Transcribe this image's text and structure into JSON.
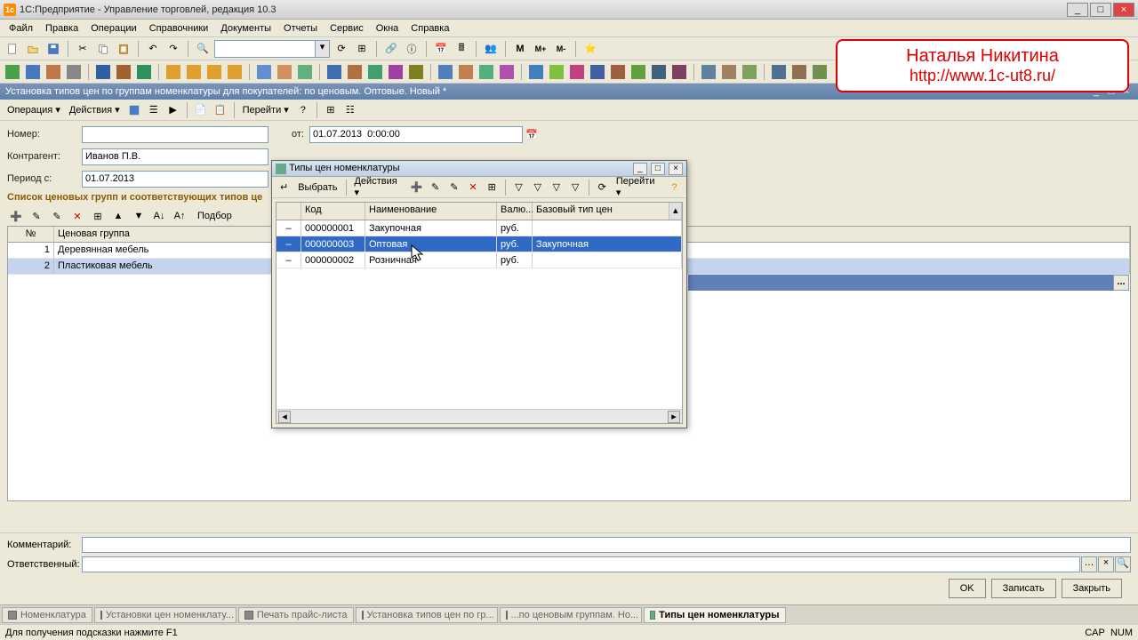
{
  "app": {
    "title": "1С:Предприятие - Управление торговлей, редакция 10.3"
  },
  "menu": [
    "Файл",
    "Правка",
    "Операции",
    "Справочники",
    "Документы",
    "Отчеты",
    "Сервис",
    "Окна",
    "Справка"
  ],
  "watermark": {
    "name": "Наталья Никитина",
    "url": "http://www.1c-ut8.ru/"
  },
  "doc": {
    "title": "Установка типов цен по группам номенклатуры для покупателей: по ценовым. Оптовые. Новый *",
    "toolbar": {
      "operation": "Операция ▾",
      "actions": "Действия ▾",
      "go": "Перейти ▾"
    },
    "fields": {
      "number_label": "Номер:",
      "number": "",
      "from_label": "от:",
      "from": "01.07.2013  0:00:00",
      "contragent_label": "Контрагент:",
      "contragent": "Иванов П.В.",
      "period_label": "Период с:",
      "period": "01.07.2013"
    },
    "section": "Список ценовых групп и соответствующих типов це",
    "local_tb": {
      "select": "Подбор"
    },
    "grid": {
      "cols": [
        "№",
        "Ценовая группа"
      ],
      "rows": [
        {
          "n": "1",
          "name": "Деревянная мебель"
        },
        {
          "n": "2",
          "name": "Пластиковая мебель"
        }
      ]
    },
    "comment_label": "Комментарий:",
    "resp_label": "Ответственный:",
    "buttons": {
      "ok": "OK",
      "save": "Записать",
      "close": "Закрыть"
    }
  },
  "popup": {
    "title": "Типы цен номенклатуры",
    "tb": {
      "choose": "Выбрать",
      "actions": "Действия ▾",
      "go": "Перейти ▾"
    },
    "cols": {
      "code": "Код",
      "name": "Наименование",
      "cur": "Валю...",
      "base": "Базовый тип цен"
    },
    "rows": [
      {
        "code": "000000001",
        "name": "Закупочная",
        "cur": "руб.",
        "base": ""
      },
      {
        "code": "000000003",
        "name": "Оптовая",
        "cur": "руб.",
        "base": "Закупочная"
      },
      {
        "code": "000000002",
        "name": "Розничная",
        "cur": "руб.",
        "base": ""
      }
    ],
    "selected": 1
  },
  "tasks": [
    "Номенклатура",
    "Установки цен номенклату...",
    "Печать прайс-листа",
    "Установка типов цен по гр...",
    "...по ценовым группам. Но...",
    "Типы цен номенклатуры"
  ],
  "status": {
    "hint": "Для получения подсказки нажмите F1",
    "cap": "CAP",
    "num": "NUM"
  }
}
